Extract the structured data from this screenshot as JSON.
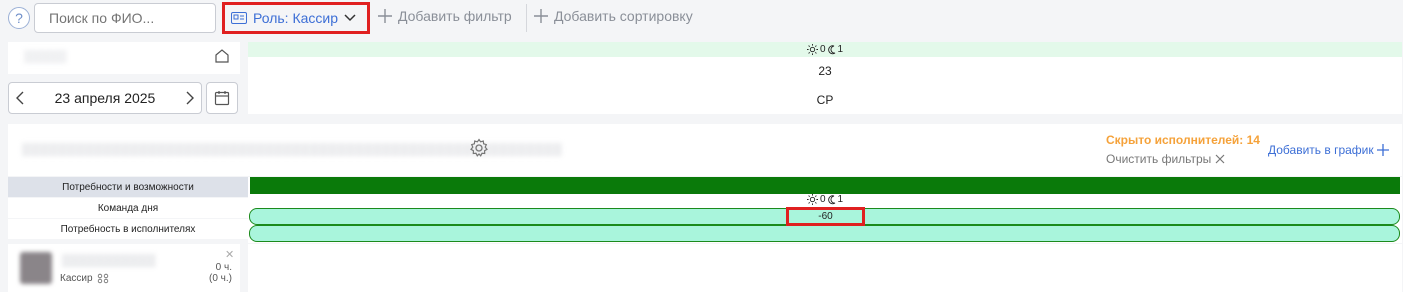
{
  "toolbar": {
    "help_label": "?",
    "search_placeholder": "Поиск по ФИО...",
    "role_filter_label": "Роль: Кассир",
    "add_filter_label": "Добавить фильтр",
    "add_sort_label": "Добавить сортировку"
  },
  "date_nav": {
    "current_date": "23 апреля 2025",
    "prev_icon": "chevron-left-icon",
    "next_icon": "chevron-right-icon"
  },
  "day_header": {
    "day_shift_count": "0",
    "night_shift_count": "1",
    "day_number": "23",
    "weekday": "СР"
  },
  "section": {
    "hidden_executors": "Скрыто исполнителей: 14",
    "clear_filters_label": "Очистить фильтры",
    "add_to_schedule_label": "Добавить в график"
  },
  "rows": {
    "needs_label": "Потребности и возможности",
    "team_label": "Команда дня",
    "executors_label": "Потребность в исполнителях",
    "day_shift_count": "0",
    "night_shift_count": "1",
    "delta_value": "-60"
  },
  "employee": {
    "role": "Кассир",
    "hours": "0 ч.",
    "hours_paren": "(0 ч.)"
  },
  "colors": {
    "accent": "#3d6fd6",
    "highlight": "#e02020",
    "warning": "#f5a23a",
    "dark_green": "#0a7a0a",
    "mint": "#a9f5dc"
  }
}
